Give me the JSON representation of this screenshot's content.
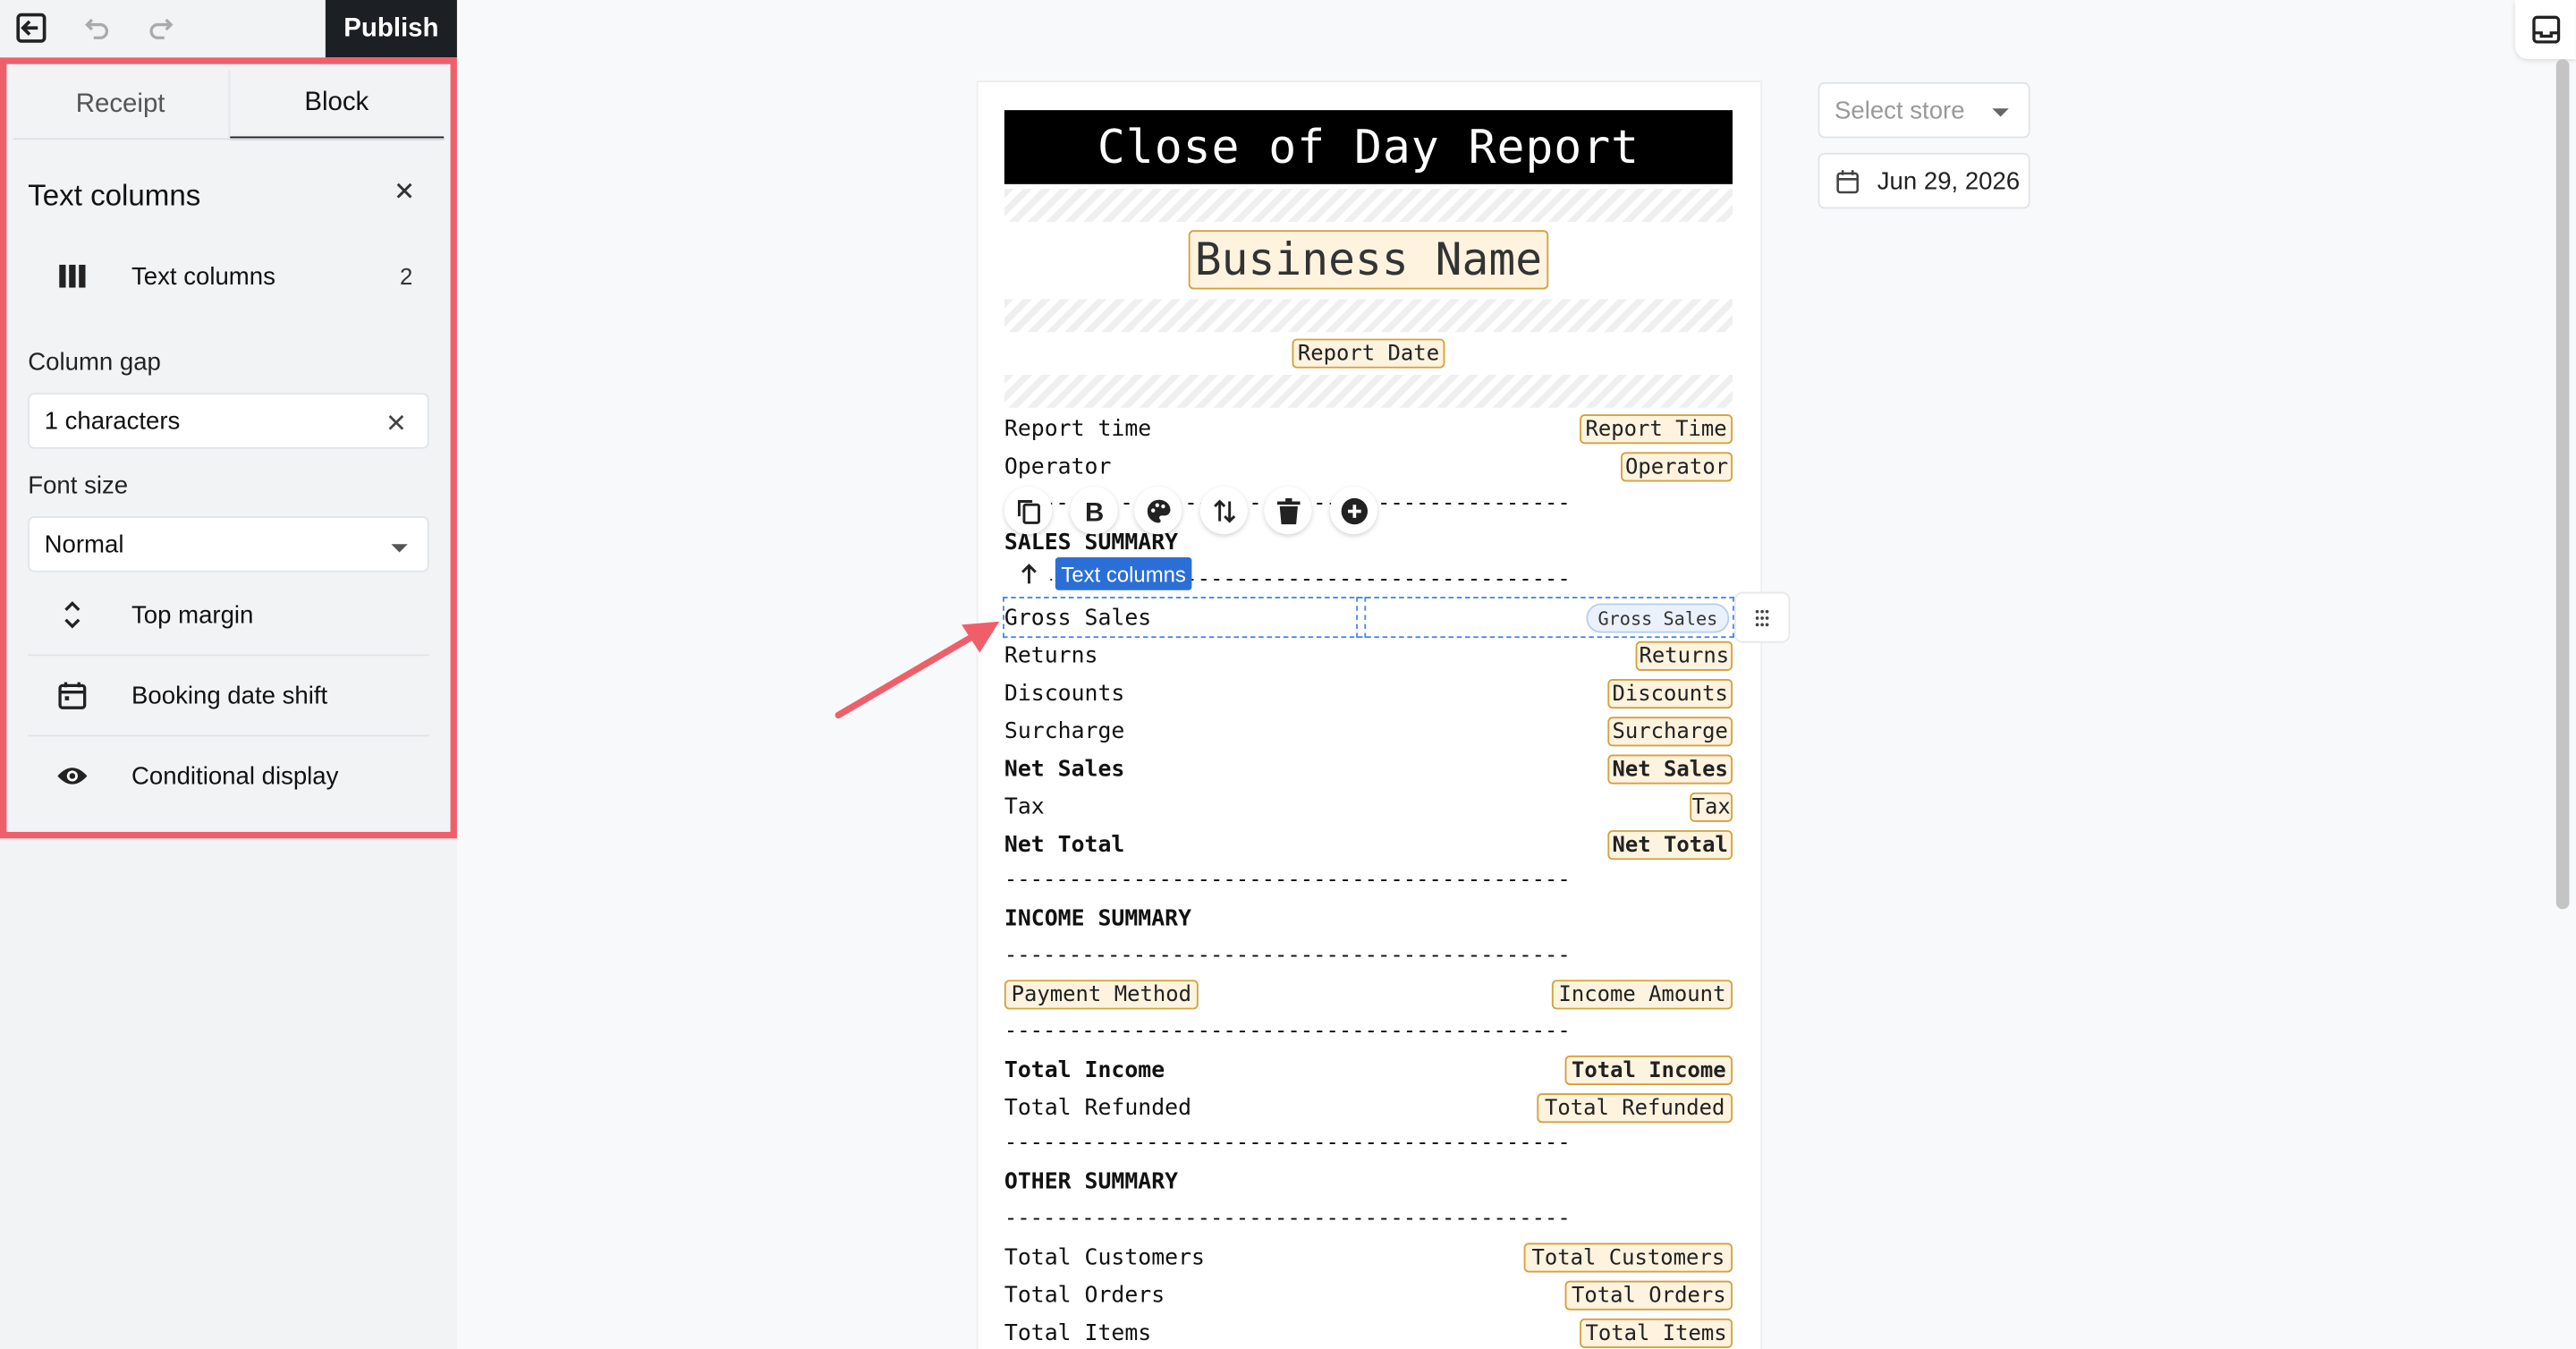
{
  "toolbar": {
    "publish_label": "Publish"
  },
  "sidebar": {
    "tabs": [
      {
        "label": "Receipt",
        "active": false
      },
      {
        "label": "Block",
        "active": true
      }
    ],
    "panel_title": "Text columns",
    "text_columns": {
      "label": "Text columns",
      "value": "2"
    },
    "column_gap": {
      "label": "Column gap",
      "value": "1 characters"
    },
    "font_size": {
      "label": "Font size",
      "value": "Normal"
    },
    "items": [
      {
        "label": "Top margin",
        "icon": "expand-vertical-icon"
      },
      {
        "label": "Booking date shift",
        "icon": "calendar-icon"
      },
      {
        "label": "Conditional display",
        "icon": "eye-icon"
      }
    ]
  },
  "receipt": {
    "title": "Close of Day Report",
    "business_name": "Business Name",
    "report_date": "Report Date",
    "rows_top": [
      {
        "label": "Report time",
        "value": "Report Time"
      },
      {
        "label": "Operator",
        "value": "Operator"
      }
    ],
    "sales_heading": "SALES SUMMARY",
    "selected_block_label": "Text columns",
    "gross_sales": {
      "label": "Gross Sales",
      "value": "Gross Sales"
    },
    "sales_rows": [
      {
        "label": "Returns",
        "value": "Returns"
      },
      {
        "label": "Discounts",
        "value": "Discounts"
      },
      {
        "label": "Surcharge",
        "value": "Surcharge"
      },
      {
        "label": "Net Sales",
        "value": "Net Sales"
      },
      {
        "label": "Tax",
        "value": "Tax"
      },
      {
        "label": "Net Total",
        "value": "Net Total"
      }
    ],
    "income_heading": "INCOME SUMMARY",
    "income_header": {
      "label": "Payment Method",
      "value": "Income Amount"
    },
    "income_rows": [
      {
        "label": "Total Income",
        "value": "Total Income"
      },
      {
        "label": "Total Refunded",
        "value": "Total Refunded"
      }
    ],
    "other_heading": "OTHER SUMMARY",
    "other_rows": [
      {
        "label": "Total Customers",
        "value": "Total Customers"
      },
      {
        "label": "Total Orders",
        "value": "Total Orders"
      },
      {
        "label": "Total Items",
        "value": "Total Items"
      }
    ],
    "dashes": "--------------------------------------------"
  },
  "right": {
    "store_placeholder": "Select store",
    "date": "Jun 29, 2026"
  },
  "colors": {
    "accent": "#2b6fd6",
    "highlight_border": "#ef5f6a",
    "placeholder_tag": "#fdf3df",
    "placeholder_border": "#d4a13c"
  }
}
